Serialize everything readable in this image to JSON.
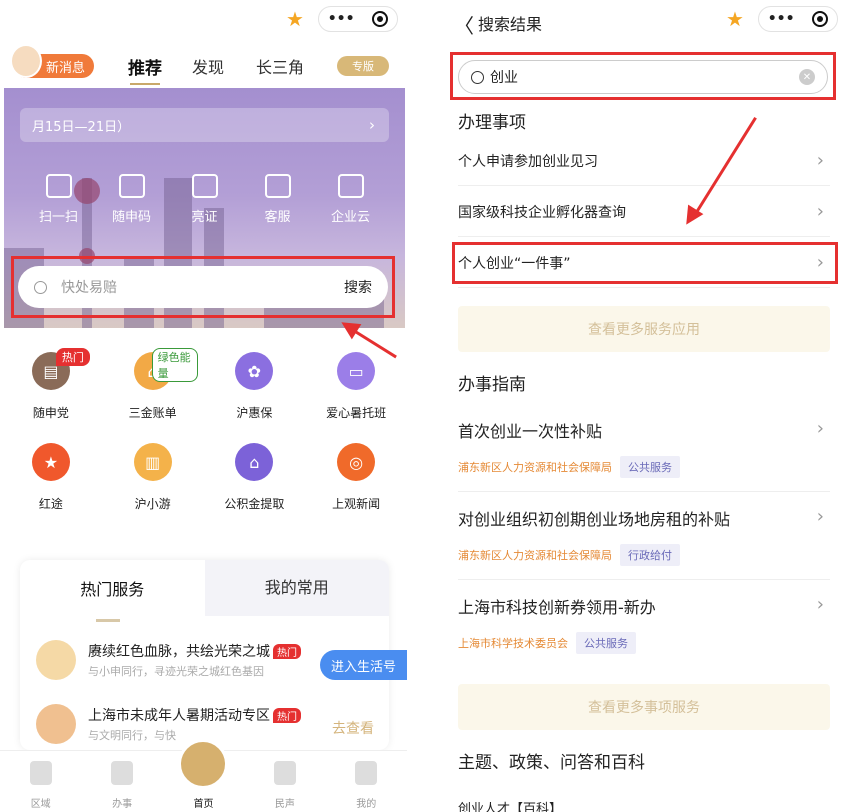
{
  "left": {
    "capsule": {
      "more": "•••"
    },
    "header": {
      "new_msg": "新消息",
      "tabs": [
        "推荐",
        "发现",
        "长三角"
      ],
      "special": "专版"
    },
    "banner": {
      "week": "月15日—21日）",
      "quick": [
        "扫一扫",
        "随申码",
        "亮证",
        "客服",
        "企业云"
      ],
      "search_placeholder": "快处易赔",
      "search_button": "搜索"
    },
    "grid": [
      {
        "label": "随申党",
        "badge": "热门",
        "color": "#8a6b58"
      },
      {
        "label": "三金账单",
        "badge": "绿色能量",
        "color": "#f2a946"
      },
      {
        "label": "沪惠保",
        "badge": "",
        "color": "#8b6fe0"
      },
      {
        "label": "爱心暑托班",
        "badge": "",
        "color": "#9b7ee8"
      },
      {
        "label": "红途",
        "badge": "",
        "color": "#f0582c"
      },
      {
        "label": "沪小游",
        "badge": "",
        "color": "#f4b24a"
      },
      {
        "label": "公积金提取",
        "badge": "",
        "color": "#7c62d8"
      },
      {
        "label": "上观新闻",
        "badge": "",
        "color": "#f06a2a"
      }
    ],
    "hot": {
      "tabs": [
        "热门服务",
        "我的常用"
      ],
      "items": [
        {
          "title": "赓续红色血脉，共绘光荣之城",
          "tag": "热门",
          "sub": "与小申同行，寻迹光荣之城红色基因"
        },
        {
          "title": "上海市未成年人暑期活动专区",
          "tag": "热门",
          "sub": "与文明同行，与快"
        }
      ],
      "enter": "进入生活号",
      "go_look": "去查看"
    },
    "tabbar": [
      "区域",
      "办事",
      "首页",
      "民声",
      "我的"
    ]
  },
  "right": {
    "nav": {
      "back": "〈",
      "title": "搜索结果"
    },
    "capsule": {
      "more": "•••"
    },
    "search": {
      "value": "创业"
    },
    "sections": {
      "affairs": "办理事项",
      "guide": "办事指南",
      "topics": "主题、政策、问答和百科"
    },
    "affairs": [
      "个人申请参加创业见习",
      "国家级科技企业孵化器查询",
      "个人创业“一件事”"
    ],
    "more_apps": "查看更多服务应用",
    "guides": [
      {
        "title": "首次创业一次性补贴",
        "org": "浦东新区人力资源和社会保障局",
        "tag": "公共服务"
      },
      {
        "title": "对创业组织初创期创业场地房租的补贴",
        "org": "浦东新区人力资源和社会保障局",
        "tag": "行政给付"
      },
      {
        "title": "上海市科技创新券领用-新办",
        "org": "上海市科学技术委员会",
        "tag": "公共服务"
      }
    ],
    "more_affairs": "查看更多事项服务",
    "topic_item": "创业人才【百科】"
  }
}
